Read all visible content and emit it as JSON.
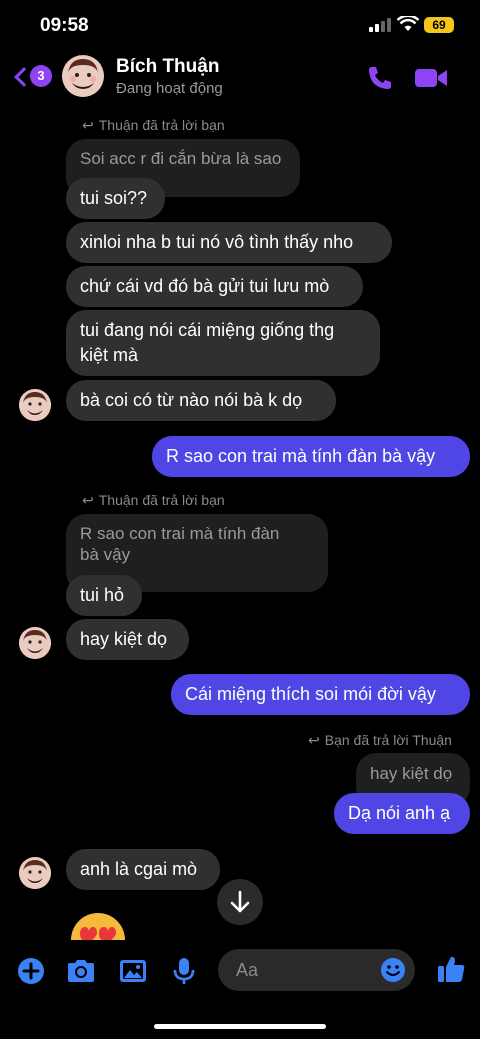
{
  "status_bar": {
    "time": "09:58",
    "battery": "69"
  },
  "header": {
    "back_count": "3",
    "contact_name": "Bích Thuận",
    "presence": "Đang hoạt động",
    "icons": {
      "call": "phone-icon",
      "video": "video-camera-icon"
    }
  },
  "messages": {
    "reply_header_1": "Thuận đã trả lời bạn",
    "quoted_1": "Soi acc r đi cắn bừa là sao",
    "m1": "tui soi??",
    "m2": "xinloi nha b tui nó vô tình thấy nho",
    "m3": "chứ cái vd đó bà gửi tui lưu mò",
    "m4_line1": "tui đang nói cái miệng giống thg",
    "m4_line2": "kiệt mà",
    "m5": "bà coi có từ nào nói bà k dọ",
    "out1": "R sao con trai mà tính đàn bà vậy",
    "reply_header_2": "Thuận đã trả lời bạn",
    "quoted_2_line1": "R sao con trai mà tính đàn",
    "quoted_2_line2": "bà vậy",
    "m6": "tui hỏ",
    "m7": "hay kiệt dọ",
    "out2": "Cái miệng thích soi mói đời vậy",
    "reply_header_3": "Bạn đã trả lời Thuận",
    "quoted_3": "hay kiệt dọ",
    "out3": "Dạ nói anh ạ",
    "m8": "anh là cgai mò"
  },
  "composer": {
    "placeholder": "Aa",
    "icons": [
      "plus-icon",
      "camera-icon",
      "image-icon",
      "microphone-icon",
      "emoji-icon",
      "thumbs-up-icon"
    ]
  },
  "colors": {
    "accent": "#8e44f5",
    "outgoing_bubble": "#4f46e5",
    "incoming_bubble": "#303030",
    "background": "#000000"
  }
}
